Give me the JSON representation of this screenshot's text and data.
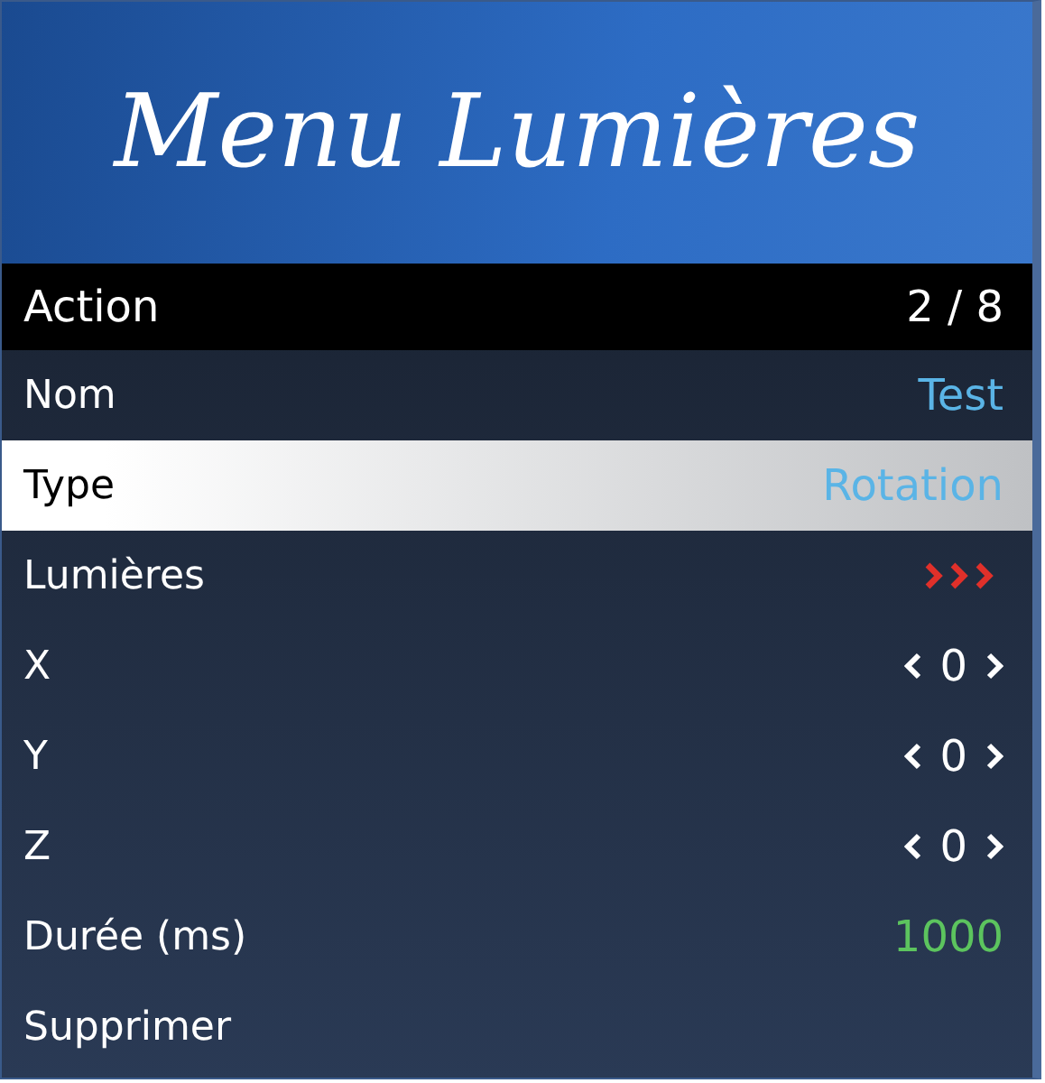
{
  "banner": {
    "title": "Menu Lumières"
  },
  "subtitle": {
    "label": "Action",
    "counter": "2 / 8"
  },
  "items": [
    {
      "label": "Nom",
      "kind": "text",
      "value": "Test",
      "color": "#5ab4e6",
      "selected": false
    },
    {
      "label": "Type",
      "kind": "text",
      "value": "Rotation",
      "color": "#5ab4e6",
      "selected": true
    },
    {
      "label": "Lumières",
      "kind": "submenu",
      "selected": false
    },
    {
      "label": "X",
      "kind": "list",
      "value": "0",
      "selected": false
    },
    {
      "label": "Y",
      "kind": "list",
      "value": "0",
      "selected": false
    },
    {
      "label": "Z",
      "kind": "list",
      "value": "0",
      "selected": false
    },
    {
      "label": "Durée (ms)",
      "kind": "text",
      "value": "1000",
      "color": "#5cc45e",
      "selected": false
    },
    {
      "label": "Supprimer",
      "kind": "action",
      "selected": false
    }
  ]
}
